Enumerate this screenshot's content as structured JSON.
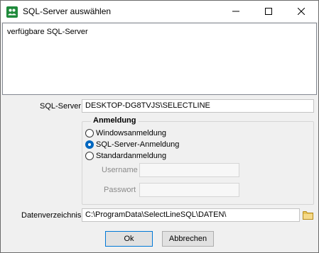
{
  "window": {
    "title": "SQL-Server auswählen",
    "icon": "app-icon",
    "controls": [
      "minimize-icon",
      "maximize-icon",
      "close-icon"
    ]
  },
  "server_list": {
    "label": "verfügbare SQL-Server"
  },
  "sql_server": {
    "label": "SQL-Server :",
    "value": "DESKTOP-DG8TVJS\\SELECTLINE"
  },
  "login": {
    "title": "Anmeldung",
    "options": [
      {
        "label": "Windowsanmeldung",
        "checked": false
      },
      {
        "label": "SQL-Server-Anmeldung",
        "checked": true
      },
      {
        "label": "Standardanmeldung",
        "checked": false
      }
    ],
    "username_label": "Username",
    "username_value": "",
    "password_label": "Passwort",
    "password_value": ""
  },
  "data_dir": {
    "label": "Datenverzeichnis:",
    "value": "C:\\ProgramData\\SelectLineSQL\\DATEN\\",
    "browse_icon": "folder-icon"
  },
  "buttons": {
    "ok": "Ok",
    "cancel": "Abbrechen"
  },
  "colors": {
    "accent": "#0067c0",
    "icon_green": "#1f8a3b",
    "folder": "#e8c45a"
  }
}
